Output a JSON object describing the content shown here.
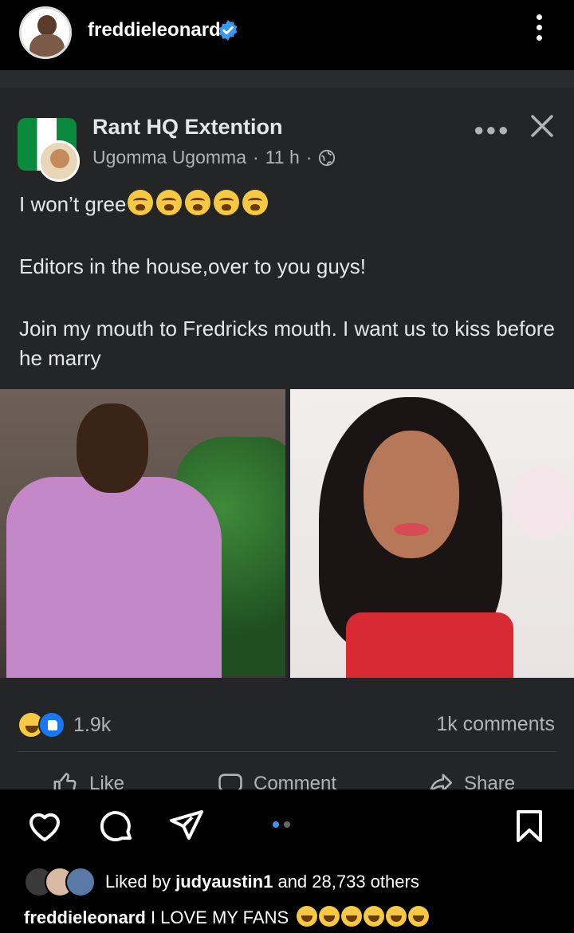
{
  "instagram": {
    "username": "freddieleonard",
    "verified": true,
    "liked_by_prefix": "Liked by",
    "liked_by_user": "judyaustin1",
    "liked_by_suffix": "and 28,733 others",
    "caption_user": "freddieleonard",
    "caption_text": "I LOVE MY FANS",
    "caption_emoji_count": 6,
    "carousel": {
      "total": 2,
      "active": 1
    }
  },
  "facebook_post": {
    "page_name": "Rant HQ Extention",
    "author": "Ugomma Ugomma",
    "time": "11 h",
    "separator": "·",
    "line1": "I won’t gree",
    "line1_emoji_count": 5,
    "line2": "Editors in the house,over to you guys!",
    "line3": "Join my mouth to Fredricks mouth. I want us to kiss before he marry",
    "reaction_count": "1.9k",
    "comments": "1k comments",
    "actions": {
      "like": "Like",
      "comment": "Comment",
      "share": "Share"
    }
  },
  "colors": {
    "fb_background": "#242526",
    "fb_text": "#e4e6eb",
    "fb_secondary": "#b0b3b8",
    "verified_blue": "#3897f0",
    "like_blue": "#1877f2"
  }
}
